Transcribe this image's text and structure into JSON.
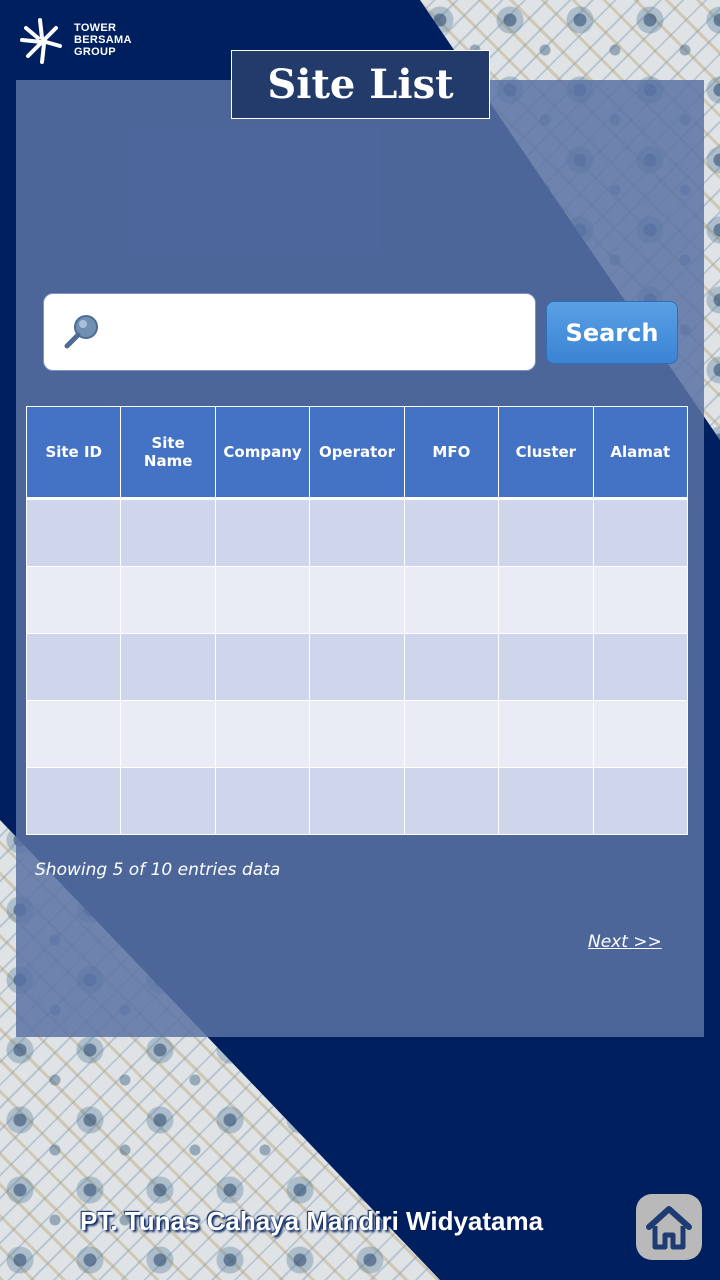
{
  "logo": {
    "lines": [
      "TOWER",
      "BERSAMA",
      "GROUP"
    ],
    "icon": "sunburst-logo-icon"
  },
  "title": "Site List",
  "search": {
    "placeholder": "",
    "value": "",
    "icon": "search-icon",
    "button_label": "Search"
  },
  "table": {
    "headers": [
      "Site ID",
      "Site Name",
      "Company",
      "Operator",
      "MFO",
      "Cluster",
      "Alamat"
    ],
    "rows": [
      [
        "",
        "",
        "",
        "",
        "",
        "",
        ""
      ],
      [
        "",
        "",
        "",
        "",
        "",
        "",
        ""
      ],
      [
        "",
        "",
        "",
        "",
        "",
        "",
        ""
      ],
      [
        "",
        "",
        "",
        "",
        "",
        "",
        ""
      ],
      [
        "",
        "",
        "",
        "",
        "",
        "",
        ""
      ]
    ]
  },
  "footer": {
    "entries_text": "Showing 5 of 10 entries data",
    "next_label": "Next >>",
    "company": "PT. Tunas Cahaya Mandiri Widyatama",
    "home_icon": "home-icon"
  },
  "colors": {
    "background": "#001f5f",
    "header": "#4472c4",
    "row_odd": "#cfd5ea",
    "row_even": "#e9ebf5",
    "button": "#4a90dd"
  }
}
